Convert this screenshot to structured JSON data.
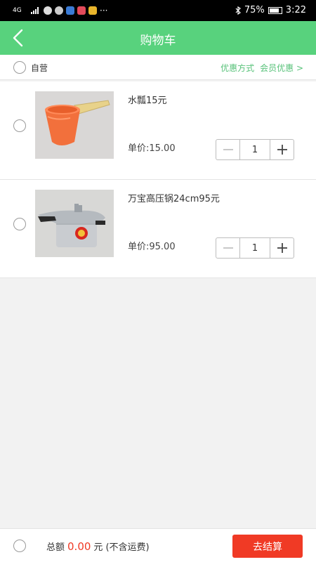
{
  "status_bar": {
    "network": "4G",
    "bluetooth_icon": "bluetooth-icon",
    "battery_percent": "75%",
    "time": "3:22",
    "more": "···"
  },
  "header": {
    "title": "购物车",
    "back_icon": "chevron-left-icon",
    "background": "#58d27d"
  },
  "shop": {
    "name": "自营",
    "promo_label": "优惠方式",
    "member_label": "会员优惠 >"
  },
  "items": [
    {
      "name": "水瓢15元",
      "price": "单价:15.00",
      "quantity": "1",
      "image": "orange-plastic-ladle"
    },
    {
      "name": "万宝高压锅24cm95元",
      "price": "单价:95.00",
      "quantity": "1",
      "image": "aluminum-pressure-cooker"
    }
  ],
  "footer": {
    "total_label": "总额",
    "total_amount": "0.00",
    "currency": "元",
    "note": "(不含运费)",
    "checkout_label": "去结算",
    "accent": "#f03a25"
  }
}
